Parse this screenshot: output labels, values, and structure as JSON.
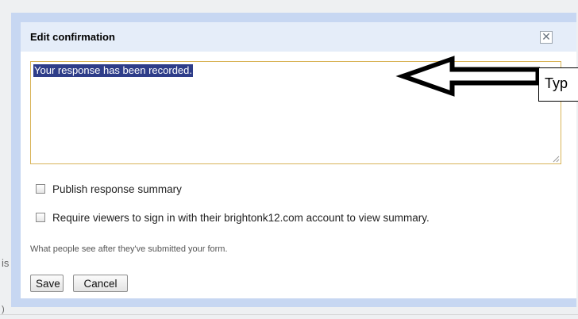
{
  "dialog": {
    "title": "Edit confirmation",
    "close_glyph": "✕",
    "message_text": "Your response has been recorded.",
    "checkbox_publish_label": "Publish response summary",
    "checkbox_require_label": "Require viewers to sign in with their brightonk12.com account to view summary.",
    "hint_text": "What people see after they've submitted your form.",
    "save_label": "Save",
    "cancel_label": "Cancel"
  },
  "annotation": {
    "callout_text": "Typ",
    "arrow_icon": "left-arrow-icon"
  },
  "background": {
    "fragment_1": "is",
    "fragment_2": ")"
  }
}
